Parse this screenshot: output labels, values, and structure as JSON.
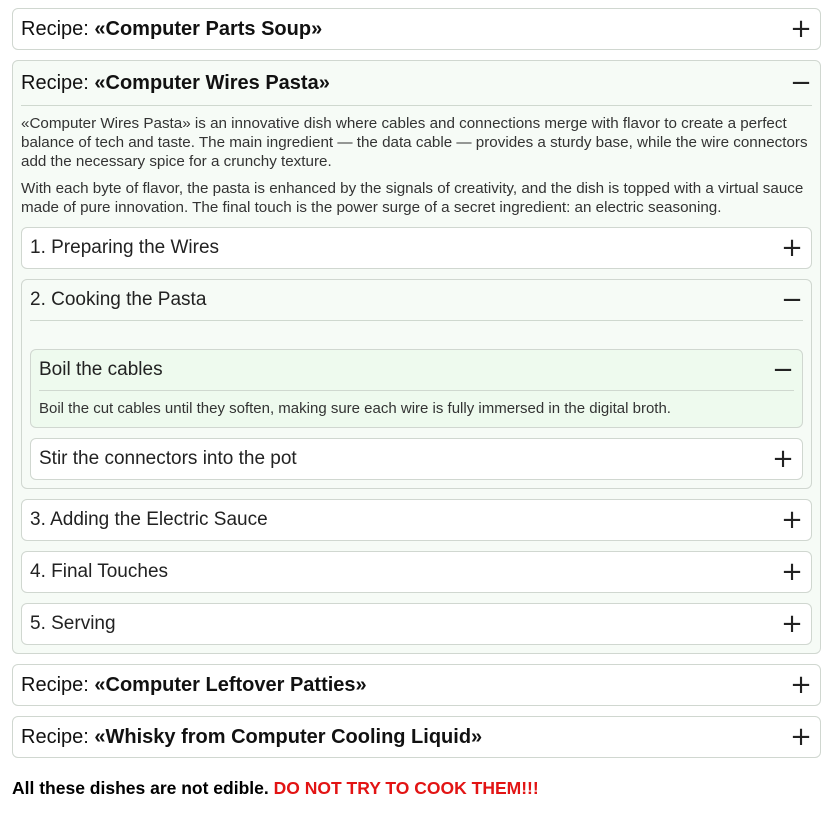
{
  "recipes": [
    {
      "prefix": "Recipe: ",
      "name": "«Computer Parts Soup»",
      "toggle": "+"
    },
    {
      "prefix": "Recipe: ",
      "name": "«Computer Wires Pasta»",
      "toggle": "−",
      "paragraphs": [
        "«Computer Wires Pasta» is an innovative dish where cables and connections merge with flavor to create a perfect balance of tech and taste. The main ingredient — the data cable — provides a sturdy base, while the wire connectors add the necessary spice for a crunchy texture.",
        "With each byte of flavor, the pasta is enhanced by the signals of creativity, and the dish is topped with a virtual sauce made of pure innovation. The final touch is the power surge of a secret ingredient: an electric seasoning."
      ],
      "steps": [
        {
          "title": "1. Preparing the Wires",
          "toggle": "+"
        },
        {
          "title": "2. Cooking the Pasta",
          "toggle": "−",
          "substeps": [
            {
              "title": "Boil the cables",
              "toggle": "−",
              "text": "Boil the cut cables until they soften, making sure each wire is fully immersed in the digital broth."
            },
            {
              "title": "Stir the connectors into the pot",
              "toggle": "+"
            }
          ]
        },
        {
          "title": "3. Adding the Electric Sauce",
          "toggle": "+"
        },
        {
          "title": "4. Final Touches",
          "toggle": "+"
        },
        {
          "title": "5. Serving",
          "toggle": "+"
        }
      ]
    },
    {
      "prefix": "Recipe: ",
      "name": "«Computer Leftover Patties»",
      "toggle": "+"
    },
    {
      "prefix": "Recipe: ",
      "name": "«Whisky from Computer Cooling Liquid»",
      "toggle": "+"
    }
  ],
  "footer": {
    "text": "All these dishes are not edible. ",
    "warning": "DO NOT TRY TO COOK THEM!!!"
  },
  "colors": {
    "warning": "#e21414",
    "open_bg": "#f6fbf6",
    "border": "#d0d7d0"
  }
}
